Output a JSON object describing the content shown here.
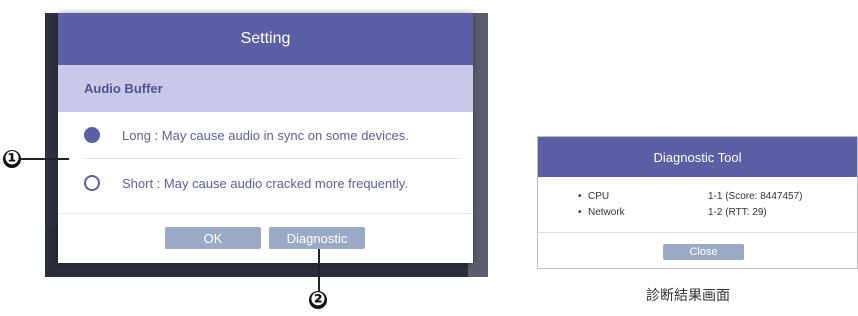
{
  "setting_dialog": {
    "title": "Setting",
    "section_title": "Audio Buffer",
    "options": [
      {
        "label": "Long : May cause audio in sync on some devices.",
        "selected": true
      },
      {
        "label": "Short : May cause audio cracked more frequently.",
        "selected": false
      }
    ],
    "ok_label": "OK",
    "diagnostic_label": "Diagnostic"
  },
  "callouts": {
    "one": "❶",
    "two": "❷"
  },
  "diagnostic_tool": {
    "title": "Diagnostic Tool",
    "rows": [
      {
        "bullet": "•",
        "key": "CPU",
        "value": "1-1 (Score: 8447457)"
      },
      {
        "bullet": "•",
        "key": "Network",
        "value": "1-2 (RTT: 29)"
      }
    ],
    "close_label": "Close"
  },
  "caption": "診断結果画面",
  "colors": {
    "header": "#5b5fa3",
    "subheader": "#c8c9e8",
    "button": "#9aaac4"
  }
}
